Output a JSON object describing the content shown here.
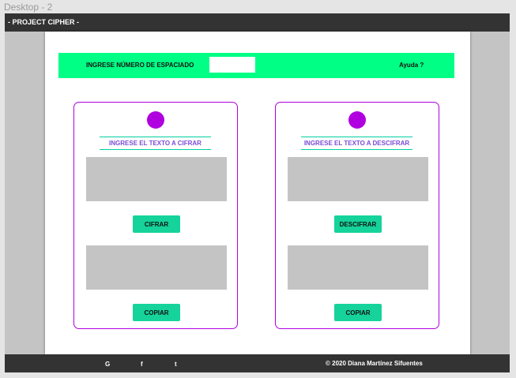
{
  "frame": {
    "label": "Desktop - 2"
  },
  "header": {
    "title": "- PROJECT CIPHER -"
  },
  "banner": {
    "spacing_label": "INGRESE NÚMERO DE ESPACIADO",
    "spacing_value": "",
    "help_label": "Ayuda ?"
  },
  "cipher_card": {
    "title": "INGRESE EL TEXTO A CIFRAR",
    "input_text": "",
    "output_text": "",
    "action_label": "CIFRAR",
    "copy_label": "COPIAR"
  },
  "decipher_card": {
    "title": "INGRESE EL TEXTO A DESCIFRAR",
    "input_text": "",
    "output_text": "",
    "action_label": "DESCIFRAR",
    "copy_label": "COPIAR"
  },
  "footer": {
    "social": [
      {
        "label": "G",
        "icon": "google-icon"
      },
      {
        "label": "f",
        "icon": "facebook-icon"
      },
      {
        "label": "t",
        "icon": "twitter-icon"
      }
    ],
    "copyright": "© 2020 Diana Martínez Sifuentes"
  },
  "colors": {
    "banner": "#00ff85",
    "accent_purple": "#b000e0",
    "button_green": "#15d39a",
    "title_text": "#7a4bd6",
    "bar": "#333333",
    "text_box": "#c4c4c4"
  }
}
